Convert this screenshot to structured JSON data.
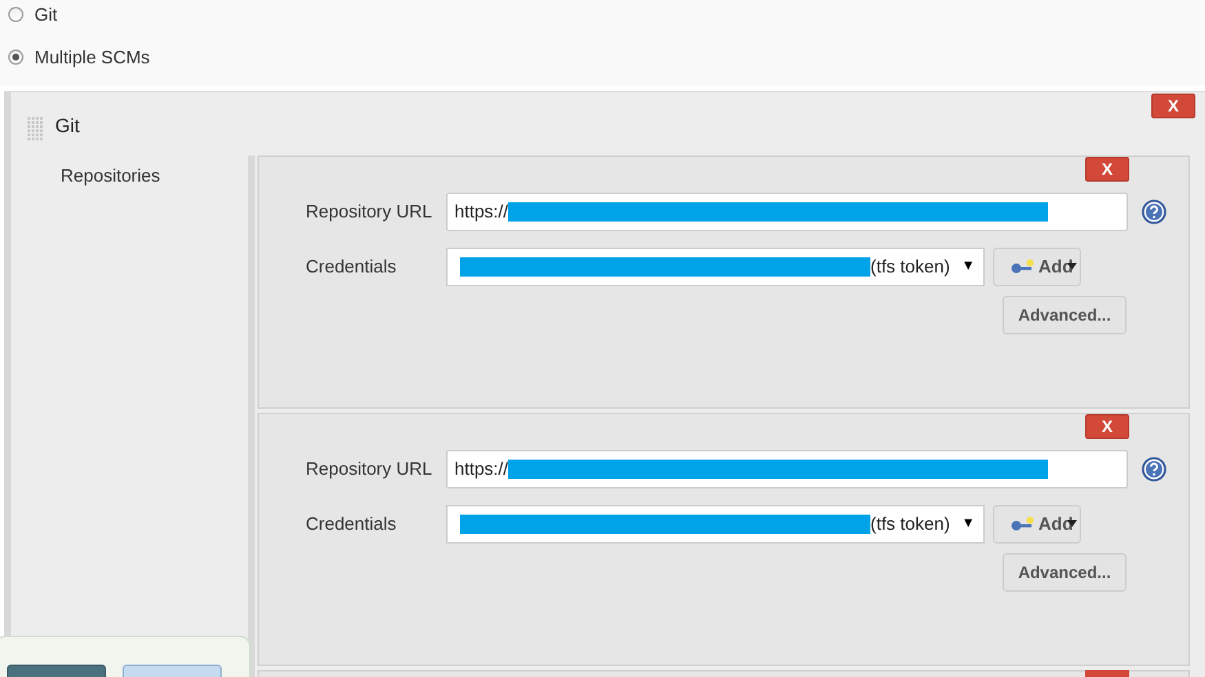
{
  "scm_options": [
    {
      "label": "Git",
      "selected": false
    },
    {
      "label": "Multiple SCMs",
      "selected": true
    }
  ],
  "scm": {
    "title": "Git",
    "delete_label": "X",
    "sidebar_label": "Repositories",
    "repositories": [
      {
        "delete_label": "X",
        "url_label": "Repository URL",
        "url_value": "https://",
        "url_redacted": true,
        "credentials_label": "Credentials",
        "credentials_value": "(tfs token)",
        "credentials_redacted": true,
        "dropdown_arrow": "▼",
        "add_label": "Add",
        "advanced_label": "Advanced..."
      },
      {
        "delete_label": "X",
        "url_label": "Repository URL",
        "url_value": "https://",
        "url_redacted": true,
        "credentials_label": "Credentials",
        "credentials_value": "(tfs token)",
        "credentials_redacted": true,
        "dropdown_arrow": "▼",
        "add_label": "Add",
        "advanced_label": "Advanced..."
      }
    ]
  }
}
